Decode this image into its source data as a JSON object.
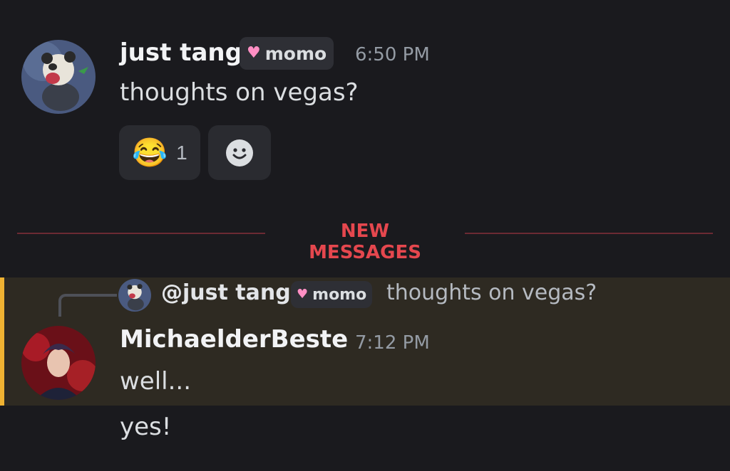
{
  "message1": {
    "username": "just tang",
    "tag": "momo",
    "time": "6:50 PM",
    "text": "thoughts on vegas?",
    "reaction": {
      "emoji": "😂",
      "count": "1"
    },
    "avatar_icon": "panda-pokemon-avatar",
    "add_reaction_icon": "smiley-add-reaction-icon"
  },
  "divider": {
    "label": "NEW MESSAGES"
  },
  "message2": {
    "reply": {
      "mention": "@just tang",
      "tag": "momo",
      "text": "thoughts on vegas?"
    },
    "username": "MichaelderBeste",
    "time": "7:12 PM",
    "text": "well...",
    "followup": "yes!",
    "avatar_icon": "anime-character-avatar"
  },
  "colors": {
    "background": "#1a1a1e",
    "new_messages": "#e5474e",
    "highlight_bar": "#f0b232",
    "highlight_bg": "#2e2a22"
  }
}
